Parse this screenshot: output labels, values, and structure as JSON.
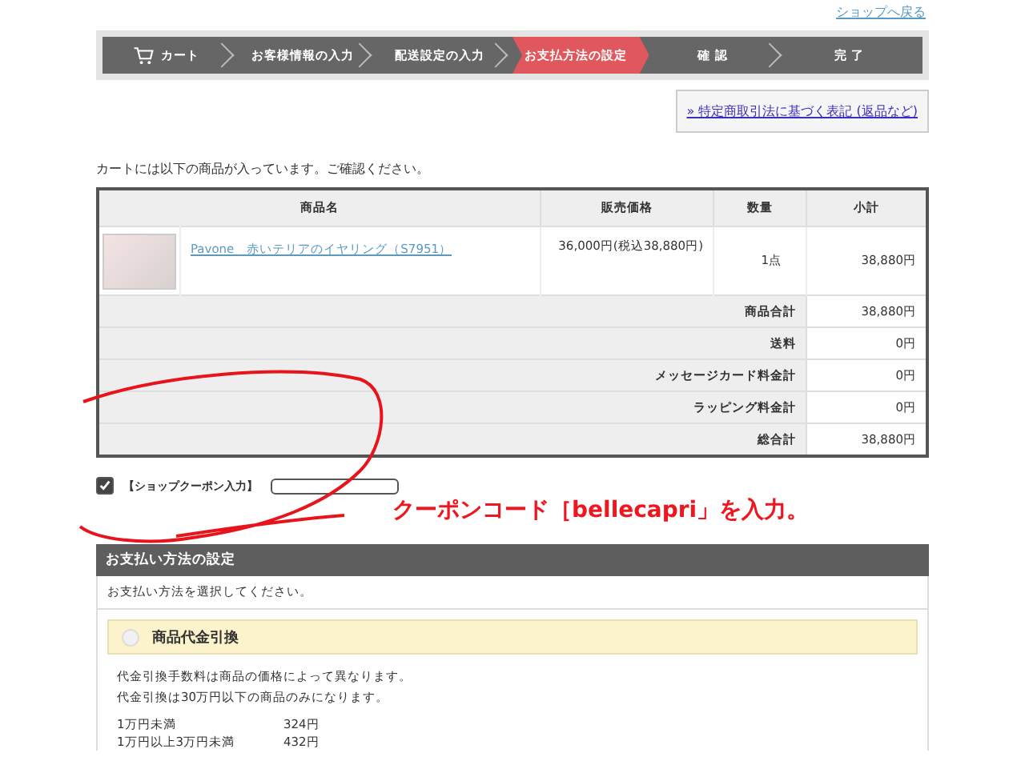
{
  "back_link": "ショップへ戻る",
  "steps": [
    {
      "label": "カート",
      "selected": false
    },
    {
      "label": "お客様情報の入力",
      "selected": false
    },
    {
      "label": "配送設定の入力",
      "selected": false
    },
    {
      "label": "お支払方法の設定",
      "selected": true
    },
    {
      "label": "確 認",
      "selected": false
    },
    {
      "label": "完 了",
      "selected": false
    }
  ],
  "law_link": "» 特定商取引法に基づく表記 (返品など)",
  "intro": "カートには以下の商品が入っています。ご確認ください。",
  "table": {
    "columns": [
      "商品名",
      "販売価格",
      "数量",
      "小計"
    ],
    "item": {
      "name": "Pavone　赤いテリアのイヤリング（S7951）",
      "price": "36,000円(税込38,880円)",
      "quantity": "1点",
      "subtotal": "38,880円"
    },
    "summary": [
      {
        "label": "商品合計",
        "value": "38,880円"
      },
      {
        "label": "送料",
        "value": "0円"
      },
      {
        "label": "メッセージカード料金計",
        "value": "0円"
      },
      {
        "label": "ラッピング料金計",
        "value": "0円"
      },
      {
        "label": "総合計",
        "value": "38,880円"
      }
    ]
  },
  "coupon": {
    "checked": true,
    "label": "【ショップクーポン入力】"
  },
  "annotation": "クーポンコード［bellecapri」を入力。",
  "payment": {
    "title": "お支払い方法の設定",
    "instruction": "お支払い方法を選択してください。",
    "option": {
      "label": "商品代金引換",
      "selected": false
    },
    "notes": [
      "代金引換手数料は商品の価格によって異なります。",
      "代金引換は30万円以下の商品のみになります。"
    ],
    "fees": [
      {
        "range": "1万円未満",
        "fee": "324円"
      },
      {
        "range": "1万円以上3万円未満",
        "fee": "432円"
      }
    ]
  }
}
